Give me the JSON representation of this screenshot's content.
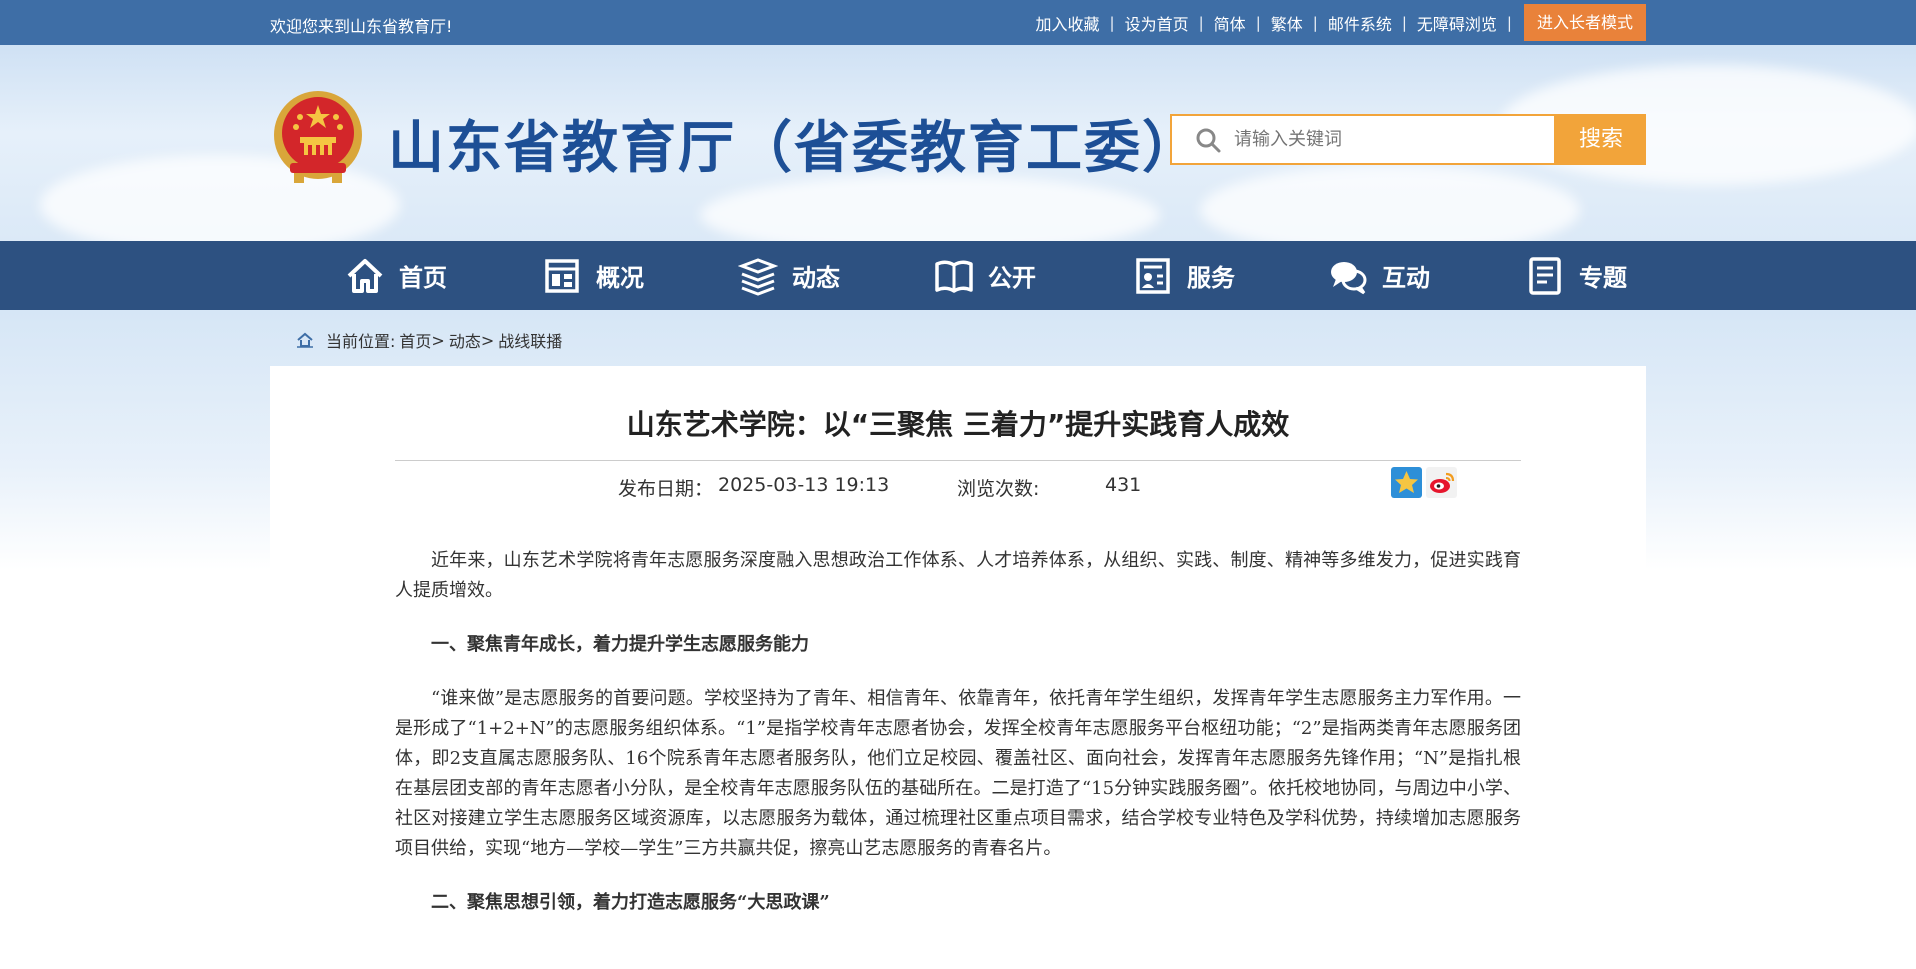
{
  "topbar": {
    "welcome": "欢迎您来到山东省教育厅!",
    "links": [
      "加入收藏",
      "设为首页",
      "简体",
      "繁体",
      "邮件系统",
      "无障碍浏览"
    ],
    "elder_mode": "进入长者模式"
  },
  "header": {
    "title": "山东省教育厅（省委教育工委）",
    "search_placeholder": "请输入关键词",
    "search_button": "搜索"
  },
  "nav": {
    "items": [
      {
        "label": "首页",
        "icon": "home-icon"
      },
      {
        "label": "概况",
        "icon": "building-icon"
      },
      {
        "label": "动态",
        "icon": "stack-icon"
      },
      {
        "label": "公开",
        "icon": "book-icon"
      },
      {
        "label": "服务",
        "icon": "service-icon"
      },
      {
        "label": "互动",
        "icon": "chat-icon"
      },
      {
        "label": "专题",
        "icon": "document-icon"
      }
    ]
  },
  "breadcrumb": {
    "prefix": "当前位置:",
    "items": [
      "首页",
      "动态",
      "战线联播"
    ],
    "separator": ">"
  },
  "article": {
    "title": "山东艺术学院：以“三聚焦 三着力”提升实践育人成效",
    "date_label": "发布日期：",
    "date_value": "2025-03-13 19:13",
    "views_label": "浏览次数:",
    "views_value": "431",
    "paragraphs": [
      {
        "type": "p",
        "text": "近年来，山东艺术学院将青年志愿服务深度融入思想政治工作体系、人才培养体系，从组织、实践、制度、精神等多维发力，促进实践育人提质增效。"
      },
      {
        "type": "h",
        "text": "一、聚焦青年成长，着力提升学生志愿服务能力"
      },
      {
        "type": "p",
        "text": "“谁来做”是志愿服务的首要问题。学校坚持为了青年、相信青年、依靠青年，依托青年学生组织，发挥青年学生志愿服务主力军作用。一是形成了“1+2+N”的志愿服务组织体系。“1”是指学校青年志愿者协会，发挥全校青年志愿服务平台枢纽功能；“2”是指两类青年志愿服务团体，即2支直属志愿服务队、16个院系青年志愿者服务队，他们立足校园、覆盖社区、面向社会，发挥青年志愿服务先锋作用；“N”是指扎根在基层团支部的青年志愿者小分队，是全校青年志愿服务队伍的基础所在。二是打造了“15分钟实践服务圈”。依托校地协同，与周边中小学、社区对接建立学生志愿服务区域资源库，以志愿服务为载体，通过梳理社区重点项目需求，结合学校专业特色及学科优势，持续增加志愿服务项目供给，实现“地方—学校—学生”三方共赢共促，擦亮山艺志愿服务的青春名片。"
      },
      {
        "type": "h",
        "text": "二、聚焦思想引领，着力打造志愿服务“大思政课”"
      }
    ]
  },
  "colors": {
    "topbar": "#3e6ea6",
    "nav": "#2d5181",
    "accent": "#f2a43a",
    "elder_button": "#e9823a",
    "title": "#1d4f96"
  }
}
